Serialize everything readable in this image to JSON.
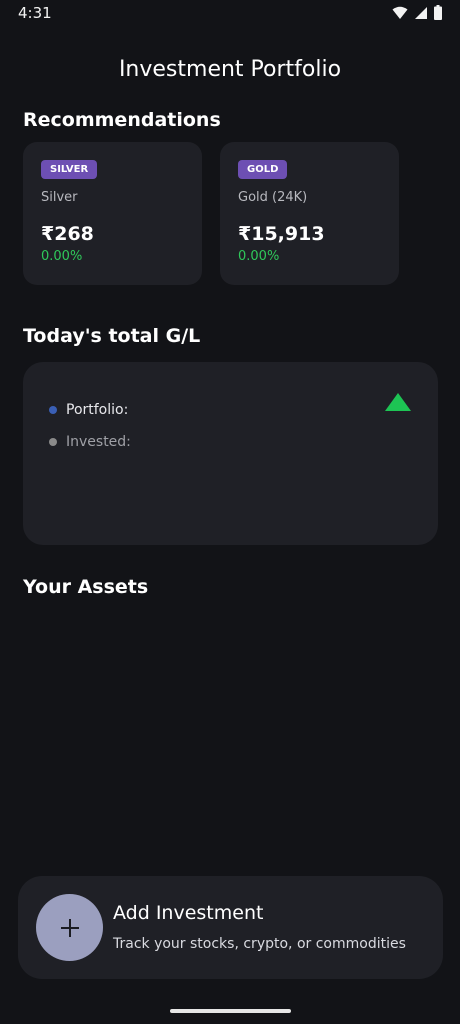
{
  "status_bar": {
    "time": "4:31"
  },
  "header": {
    "title": "Investment Portfolio"
  },
  "recommendations": {
    "title": "Recommendations",
    "cards": [
      {
        "badge": "SILVER",
        "name": "Silver",
        "price": "₹268",
        "change": "0.00%"
      },
      {
        "badge": "GOLD",
        "name": "Gold (24K)",
        "price": "₹15,913",
        "change": "0.00%"
      }
    ]
  },
  "gain_loss": {
    "title": "Today's total G/L",
    "portfolio_label": "Portfolio:",
    "invested_label": "Invested:",
    "trend_icon": "triangle-up-icon"
  },
  "assets": {
    "title": "Your Assets"
  },
  "add_investment": {
    "title": "Add Investment",
    "subtitle": "Track your stocks, crypto, or commodities",
    "icon": "plus-icon"
  },
  "colors": {
    "background": "#121317",
    "card": "#1f2026",
    "badge": "#6d4fb3",
    "positive": "#2fc85a",
    "trend_up": "#1dc454",
    "portfolio_dot": "#3a5fb5",
    "invested_dot": "#8a8a8a",
    "fab": "#9b9fbf"
  }
}
